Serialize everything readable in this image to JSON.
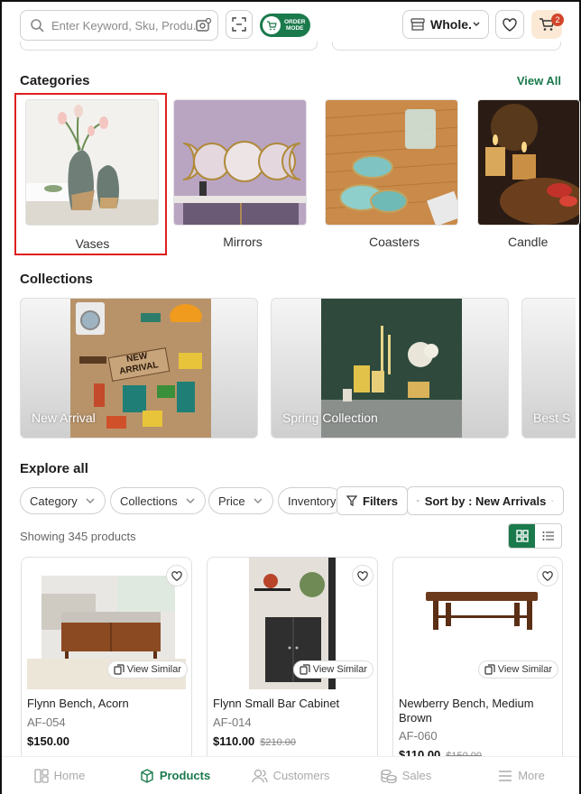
{
  "header": {
    "search_placeholder": "Enter Keyword, Sku, Produ...",
    "order_mode_label_1": "ORDER",
    "order_mode_label_2": "MODE",
    "store_selector": "Whole...",
    "cart_count": "2"
  },
  "categories": {
    "title": "Categories",
    "view_all": "View All",
    "items": [
      {
        "label": "Vases"
      },
      {
        "label": "Mirrors"
      },
      {
        "label": "Coasters"
      },
      {
        "label": "Candle"
      }
    ]
  },
  "collections": {
    "title": "Collections",
    "items": [
      {
        "label": "New Arrival",
        "sign": "NEW ARRIVAL"
      },
      {
        "label": "Spring Collection"
      },
      {
        "label": "Best S"
      }
    ]
  },
  "explore": {
    "title": "Explore all",
    "filters": [
      "Category",
      "Collections",
      "Price",
      "Inventory"
    ],
    "filters_button": "Filters",
    "sort_label": "Sort by : New Arrivals",
    "showing": "Showing 345 products"
  },
  "products": [
    {
      "name": "Flynn Bench, Acorn",
      "sku": "AF-054",
      "price": "$150.00",
      "was": "",
      "view_similar": "View Similar"
    },
    {
      "name": "Flynn Small Bar Cabinet",
      "sku": "AF-014",
      "price": "$110.00",
      "was": "$210.00",
      "view_similar": "View Similar"
    },
    {
      "name": "Newberry Bench, Medium Brown",
      "sku": "AF-060",
      "price": "$110.00",
      "was": "$150.00",
      "view_similar": "View Similar"
    }
  ],
  "bottom_nav": [
    {
      "label": "Home",
      "icon": "home-icon",
      "active": false
    },
    {
      "label": "Products",
      "icon": "box-icon",
      "active": true
    },
    {
      "label": "Customers",
      "icon": "users-icon",
      "active": false
    },
    {
      "label": "Sales",
      "icon": "coins-icon",
      "active": false
    },
    {
      "label": "More",
      "icon": "menu-icon",
      "active": false
    }
  ],
  "colors": {
    "accent": "#1a7a4c",
    "cart_bg": "#fbe9d6",
    "badge": "#d1452a",
    "selection": "#e01f1f"
  }
}
